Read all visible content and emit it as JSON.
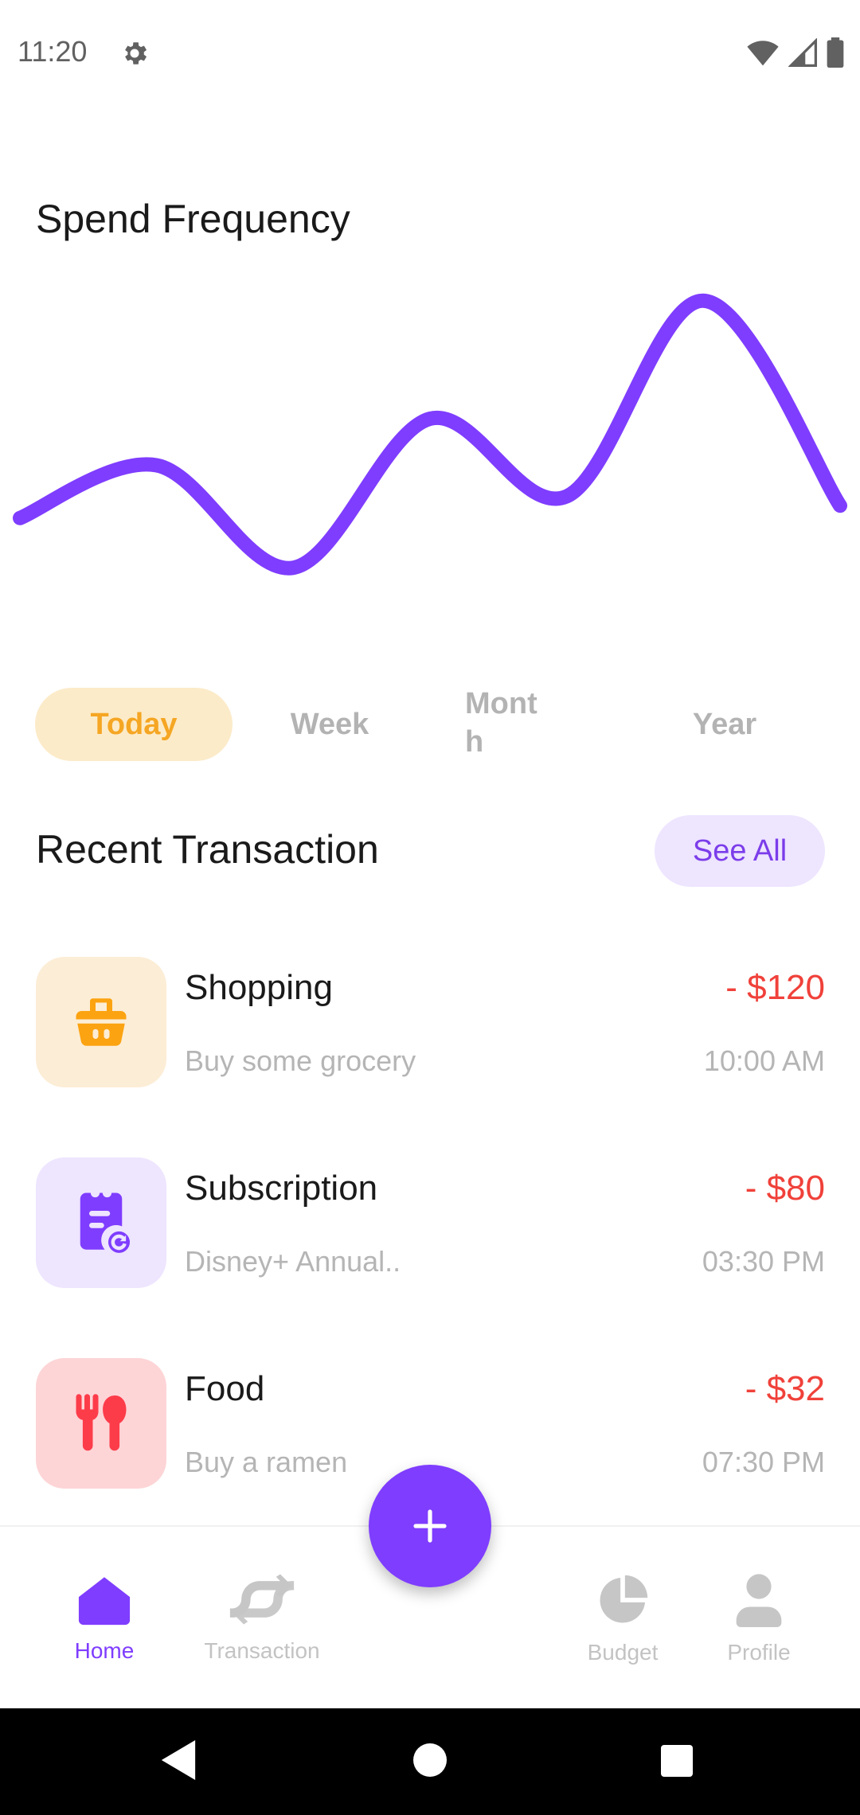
{
  "status_bar": {
    "time": "11:20"
  },
  "header": {
    "title": "Spend Frequency"
  },
  "chart_data": {
    "type": "line",
    "series": [
      {
        "values": [
          0.28,
          0.45,
          0.12,
          0.6,
          0.35,
          0.98,
          0.32
        ]
      }
    ],
    "color": "#7f3dff"
  },
  "period_tabs": {
    "items": [
      "Today",
      "Week",
      "Mont\nh",
      "Year"
    ],
    "selected": "Today"
  },
  "recent": {
    "title": "Recent Transaction",
    "see_all": "See All",
    "items": [
      {
        "name": "Shopping",
        "desc": "Buy some grocery",
        "amount": "- $120",
        "time": "10:00 AM",
        "icon": "shopping-basket-icon",
        "bg": "#fcedd6",
        "fg": "#fca311"
      },
      {
        "name": "Subscription",
        "desc": "Disney+ Annual..",
        "amount": "- $80",
        "time": "03:30 PM",
        "icon": "subscription-icon",
        "bg": "#eee5ff",
        "fg": "#7f3dff"
      },
      {
        "name": "Food",
        "desc": "Buy a ramen",
        "amount": "- $32",
        "time": "07:30 PM",
        "icon": "restaurant-icon",
        "bg": "#fdd5d7",
        "fg": "#fd3c4a"
      }
    ]
  },
  "bottom_nav": {
    "items": [
      {
        "label": "Home",
        "active": true
      },
      {
        "label": "Transaction",
        "active": false
      },
      {
        "label": "Budget",
        "active": false
      },
      {
        "label": "Profile",
        "active": false
      }
    ],
    "fab_icon": "plus-icon"
  }
}
